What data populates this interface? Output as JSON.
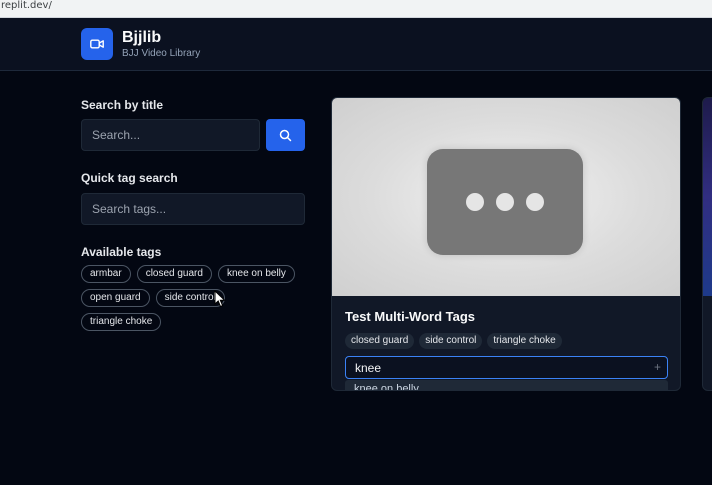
{
  "browser": {
    "url": "replit.dev/"
  },
  "header": {
    "title": "Bjjlib",
    "subtitle": "BJJ Video Library",
    "logo_icon": "video-camera-icon",
    "accent_color": "#2563eb"
  },
  "sidebar": {
    "title_search": {
      "label": "Search by title",
      "placeholder": "Search...",
      "button_icon": "search-icon"
    },
    "tag_search": {
      "label": "Quick tag search",
      "placeholder": "Search tags..."
    },
    "available_tags": {
      "label": "Available tags",
      "tags": [
        "armbar",
        "closed guard",
        "knee on belly",
        "open guard",
        "side control",
        "triangle choke"
      ]
    }
  },
  "video_card": {
    "title": "Test Multi-Word Tags",
    "thumbnail_icon": "video-unavailable-icon",
    "tags": [
      "closed guard",
      "side control",
      "triangle choke"
    ],
    "tag_input": {
      "value": "knee",
      "add_icon": "plus-icon"
    },
    "suggestion": "knee on belly"
  }
}
